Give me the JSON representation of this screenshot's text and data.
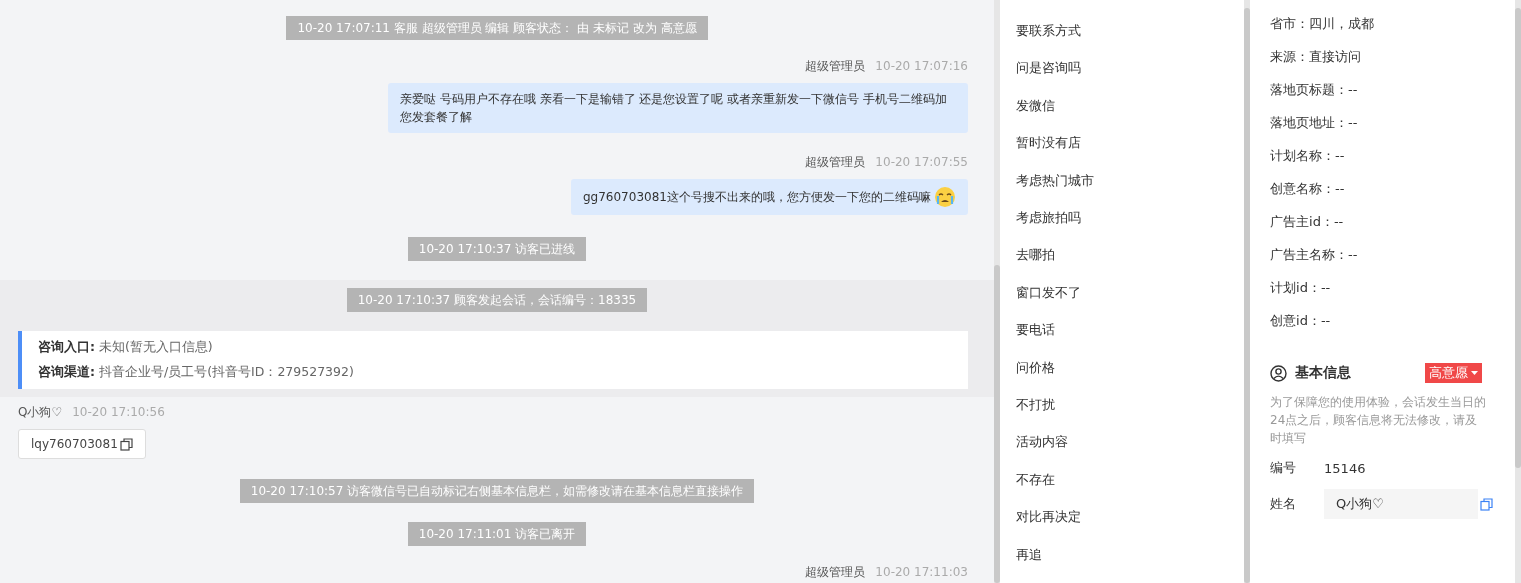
{
  "messages": [
    {
      "kind": "system",
      "text": "10-20 17:07:11 客服 超级管理员 编辑 顾客状态： 由 未标记 改为 高意愿"
    },
    {
      "kind": "agent",
      "name": "超级管理员",
      "time": "10-20 17:07:16",
      "text": "亲爱哒 号码用户不存在哦 亲看一下是输错了 还是您设置了呢 或者亲重新发一下微信号 手机号二维码加您发套餐了解",
      "emoji": false
    },
    {
      "kind": "agent",
      "name": "超级管理员",
      "time": "10-20 17:07:55",
      "text": "gg760703081这个号搜不出来的哦，您方便发一下您的二维码嘛",
      "emoji": true
    },
    {
      "kind": "system",
      "text": "10-20 17:10:37 访客已进线"
    }
  ],
  "session_start": [
    {
      "kind": "system",
      "text": "10-20 17:10:37 顾客发起会话，会话编号：18335"
    },
    {
      "kind": "entry",
      "rows": [
        {
          "label": "咨询入口:",
          "value": "未知(暂无入口信息)"
        },
        {
          "label": "咨询渠道:",
          "value": "抖音企业号/员工号(抖音号ID：279527392)"
        }
      ]
    }
  ],
  "later_messages": [
    {
      "kind": "visitor",
      "name": "Q小狗♡",
      "time": "10-20 17:10:56",
      "text": "lqy760703081"
    },
    {
      "kind": "system",
      "text": "10-20 17:10:57 访客微信号已自动标记右侧基本信息栏，如需修改请在基本信息栏直接操作"
    },
    {
      "kind": "system",
      "text": "10-20 17:11:01 访客已离开"
    },
    {
      "kind": "agent-header",
      "name": "超级管理员",
      "time": "10-20 17:11:03"
    }
  ],
  "quick_replies": [
    "要联系方式",
    "问是咨询吗",
    "发微信",
    "暂时没有店",
    "考虑热门城市",
    "考虑旅拍吗",
    "去哪拍",
    "窗口发不了",
    "要电话",
    "问价格",
    "不打扰",
    "活动内容",
    "不存在",
    "对比再决定",
    "再追"
  ],
  "source_info": [
    "省市：四川，成都",
    "来源：直接访问",
    "落地页标题：--",
    "落地页地址：--",
    "计划名称：--",
    "创意名称：--",
    "广告主id：--",
    "广告主名称：--",
    "计划id：--",
    "创意id：--"
  ],
  "basic_info": {
    "title": "基本信息",
    "status": "高意愿",
    "notice": "为了保障您的使用体验，会话发生当日的24点之后，顾客信息将无法修改，请及时填写",
    "fields": [
      {
        "label": "编号",
        "value": "15146",
        "kind": "text"
      },
      {
        "label": "姓名",
        "value": "Q小狗♡",
        "kind": "input"
      }
    ]
  }
}
